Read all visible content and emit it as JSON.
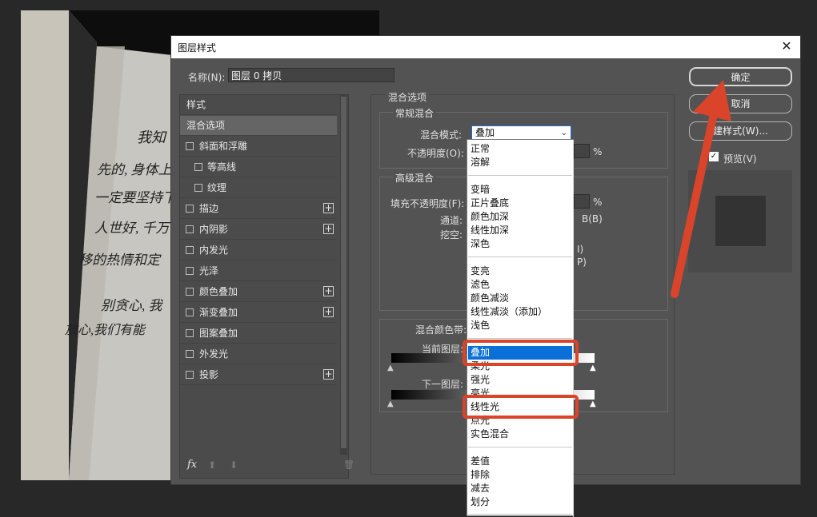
{
  "dialog": {
    "title": "图层样式",
    "close_glyph": "✕"
  },
  "name_field": {
    "label": "名称(N):",
    "value": "图层 0 拷贝"
  },
  "style_list": {
    "header": "样式",
    "items": [
      {
        "label": "混合选项"
      },
      {
        "label": "斜面和浮雕"
      },
      {
        "label": "等高线"
      },
      {
        "label": "纹理"
      },
      {
        "label": "描边"
      },
      {
        "label": "内阴影"
      },
      {
        "label": "内发光"
      },
      {
        "label": "光泽"
      },
      {
        "label": "颜色叠加"
      },
      {
        "label": "渐变叠加"
      },
      {
        "label": "图案叠加"
      },
      {
        "label": "外发光"
      },
      {
        "label": "投影"
      }
    ],
    "plus_glyph": "+",
    "fx_label": "fx",
    "up_glyph": "⬆",
    "down_glyph": "⬇",
    "trash_glyph": "🗑"
  },
  "blend_options": {
    "section_title": "混合选项",
    "general_group": "常规混合",
    "mode_label": "混合模式:",
    "mode_value": "叠加",
    "opacity_label": "不透明度(O):",
    "percent": "%",
    "advanced_group": "高级混合",
    "fill_label": "填充不透明度(F):",
    "channels_label": "通道:",
    "channel_b": "B(B)",
    "knockout_label": "挖空:",
    "partial_i": "I)",
    "partial_p": "P)",
    "blend_if_label": "混合颜色带:",
    "this_layer_label": "当前图层:",
    "under_layer_label": "下一图层:"
  },
  "buttons": {
    "ok": "确定",
    "cancel": "取消",
    "new_style": "建样式(W)...",
    "preview": "预览(V)"
  },
  "dropdown": {
    "groups": [
      [
        "正常",
        "溶解"
      ],
      [
        "变暗",
        "正片叠底",
        "颜色加深",
        "线性加深",
        "深色"
      ],
      [
        "变亮",
        "滤色",
        "颜色减淡",
        "线性减淡（添加）",
        "浅色"
      ],
      [
        "叠加",
        "柔光",
        "强光",
        "亮光",
        "线性光",
        "点光",
        "实色混合"
      ],
      [
        "差值",
        "排除",
        "减去",
        "划分"
      ]
    ],
    "selected": "叠加"
  },
  "colors": {
    "highlight": "#d9442b",
    "accent": "#0a6fd6",
    "arrow": "#d9442b"
  },
  "photo_text": [
    "我知",
    "先的, 身体上表",
    "一定要坚持下去",
    "人世好, 千万不",
    "移的热情和定",
    "别贪心, 我",
    "放心,我们有能"
  ]
}
